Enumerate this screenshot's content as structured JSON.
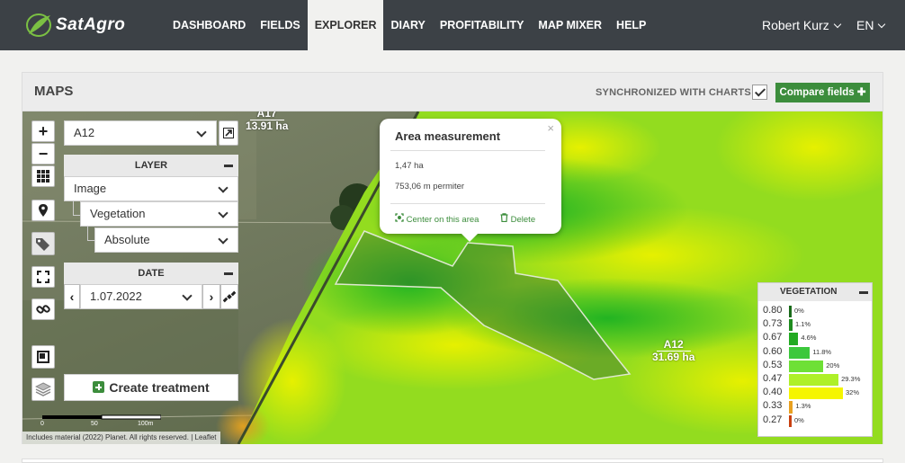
{
  "app": {
    "name": "SatAgro"
  },
  "nav": {
    "items": [
      "DASHBOARD",
      "FIELDS",
      "EXPLORER",
      "DIARY",
      "PROFITABILITY",
      "MAP MIXER",
      "HELP"
    ],
    "active": "EXPLORER"
  },
  "user": {
    "name": "Robert Kurz",
    "language": "EN"
  },
  "panel": {
    "title": "MAPS",
    "sync_label": "SYNCHRONIZED WITH CHARTS",
    "sync_checked": true,
    "compare_label": "Compare fields"
  },
  "map": {
    "field_select": "A12",
    "layer": {
      "heading": "LAYER",
      "type": "Image",
      "product": "Vegetation",
      "scale": "Absolute"
    },
    "date": {
      "heading": "DATE",
      "value": "1.07.2022"
    },
    "create_treatment_label": "Create treatment",
    "scale_bar": [
      "0",
      "50",
      "100m"
    ],
    "attribution": "Includes material (2022) Planet. All rights reserved. | Leaflet",
    "field_labels": [
      {
        "name": "A17",
        "area": "13.91 ha"
      },
      {
        "name": "A12",
        "area": "31.69 ha"
      }
    ],
    "popup": {
      "title": "Area measurement",
      "area": "1,47 ha",
      "perimeter": "753,06 m permiter",
      "center_label": "Center on this area",
      "delete_label": "Delete"
    },
    "legend": {
      "heading": "VEGETATION",
      "rows": [
        {
          "value": "0.80",
          "percent": "0%",
          "share": 0,
          "color": "#1a6b1a"
        },
        {
          "value": "0.73",
          "percent": "1.1%",
          "share": 1.1,
          "color": "#1f8c1f"
        },
        {
          "value": "0.67",
          "percent": "4.6%",
          "share": 4.6,
          "color": "#22aa22"
        },
        {
          "value": "0.60",
          "percent": "11.8%",
          "share": 11.8,
          "color": "#3cc83c"
        },
        {
          "value": "0.53",
          "percent": "20%",
          "share": 20,
          "color": "#6ee036"
        },
        {
          "value": "0.47",
          "percent": "29.3%",
          "share": 29.3,
          "color": "#aef028"
        },
        {
          "value": "0.40",
          "percent": "32%",
          "share": 32,
          "color": "#f5f500"
        },
        {
          "value": "0.33",
          "percent": "1.3%",
          "share": 1.3,
          "color": "#e8a020"
        },
        {
          "value": "0.27",
          "percent": "0%",
          "share": 0,
          "color": "#c84010"
        }
      ]
    }
  }
}
